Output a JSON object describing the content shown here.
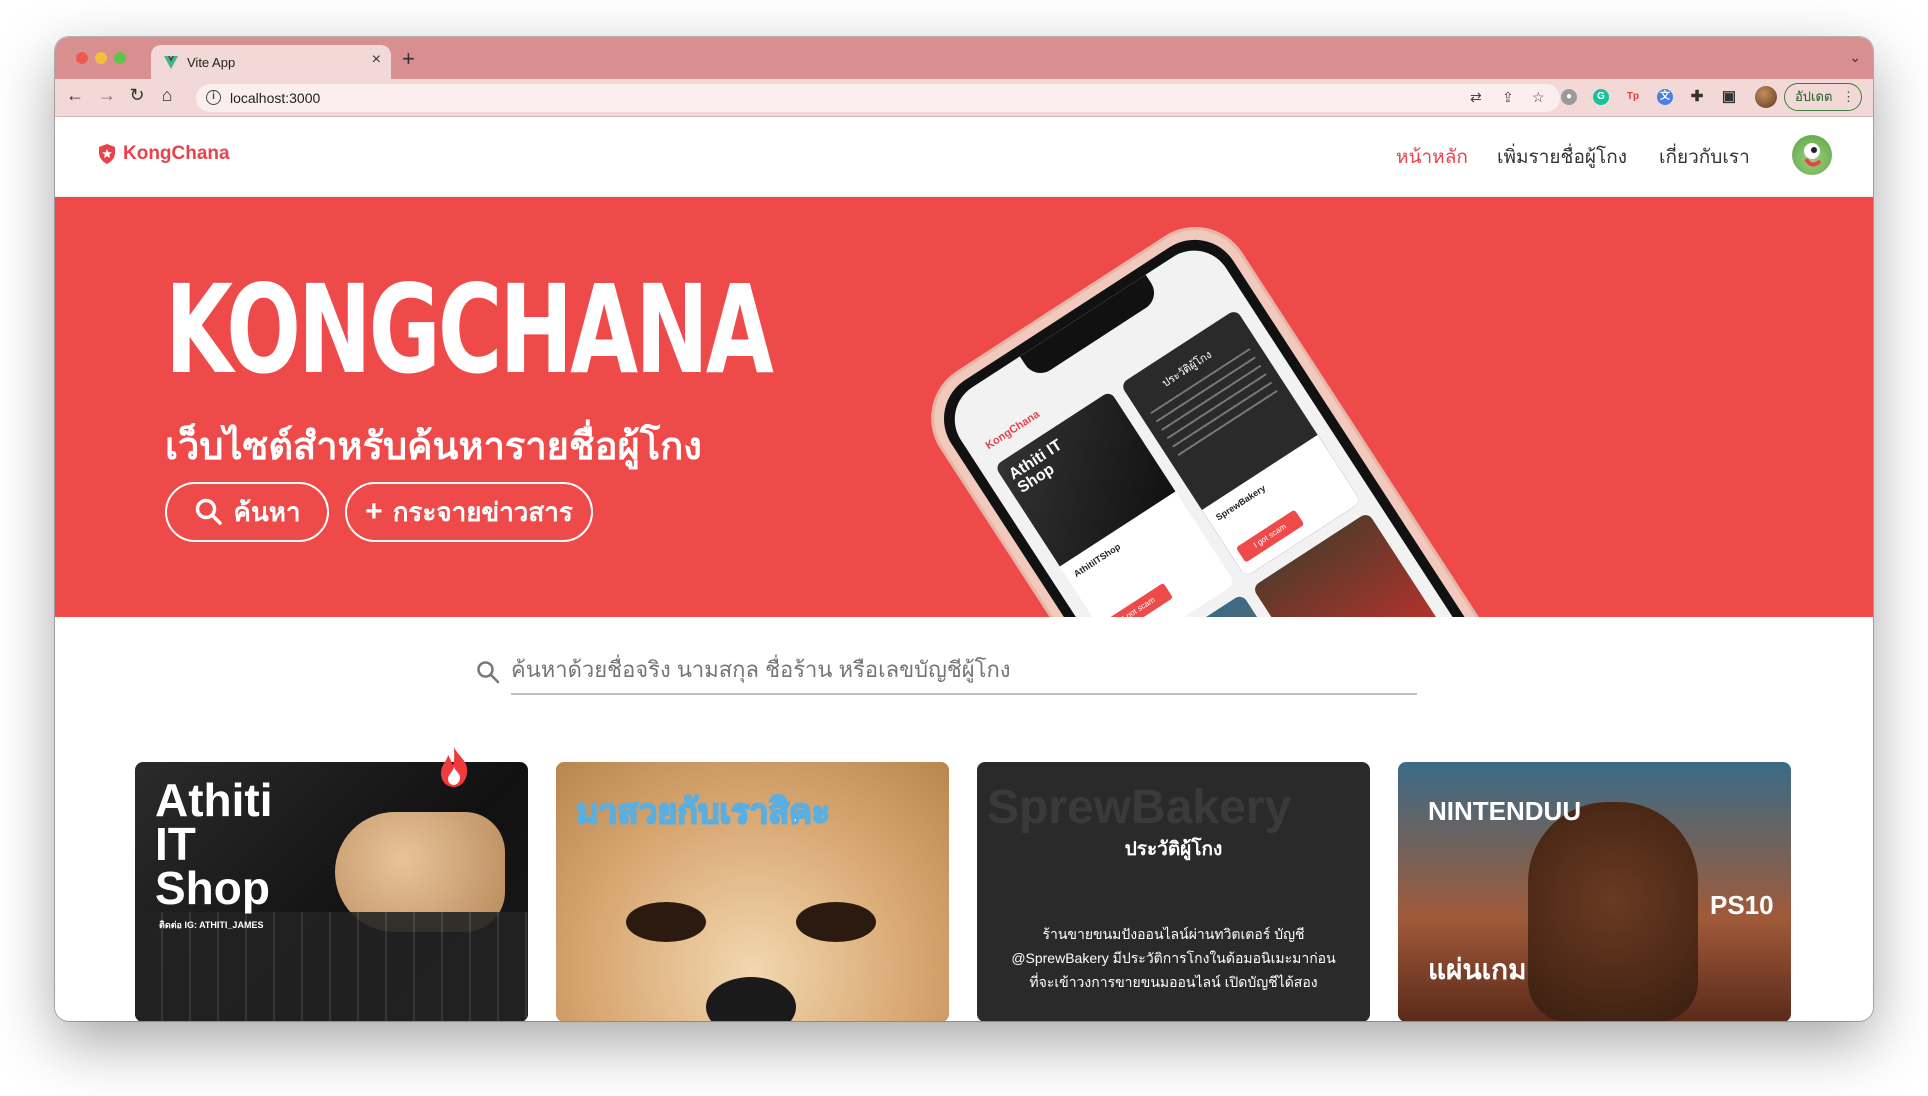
{
  "browser": {
    "tab_title": "Vite App",
    "url": "localhost:3000",
    "update_label": "อัปเดต"
  },
  "site": {
    "brand": "KongChana",
    "nav": [
      {
        "label": "หน้าหลัก"
      },
      {
        "label": "เพิ่มรายชื่อผู้โกง"
      },
      {
        "label": "เกี่ยวกับเรา"
      }
    ]
  },
  "hero": {
    "title": "KONGCHANA",
    "subtitle": "เว็บไซต์สำหรับค้นหารายชื่อผู้โกง",
    "search_button": "ค้นหา",
    "broadcast_button": "กระจายข่าวสาร"
  },
  "phone_preview": {
    "brand": "KongChana",
    "card1_title": "Athiti IT Shop",
    "card1_name": "AthitiITShop",
    "card2_heading": "ประวัติผู้โกง",
    "card2_name": "SprewBakery",
    "button": "I got scam"
  },
  "search": {
    "placeholder": "ค้นหาด้วยชื่อจริง นามสกุล ชื่อร้าน หรือเลขบัญชีผู้โกง"
  },
  "cards": [
    {
      "title_line1": "Athiti",
      "title_line2": "IT",
      "title_line3": "Shop",
      "small": "ติดต่อ IG: ATHITI_JAMES"
    },
    {
      "caption": "มาสวยกับเราสิคะ"
    },
    {
      "watermark": "SprewBakery",
      "heading": "ประวัติผู้โกง",
      "body_line1": "ร้านขายขนมปังออนไลน์ผ่านทวิตเตอร์ บัญชี",
      "body_line2": "@SprewBakery มีประวัติการโกงในด้อมอนิเมะมาก่อน",
      "body_line3": "ที่จะเข้าวงการขายขนมออนไลน์ เปิดบัญชีได้สอง"
    },
    {
      "caption_top": "NINTENDUU",
      "caption_right": "PS10",
      "caption_bottom": "แผ่นเกม"
    }
  ],
  "colors": {
    "brand_red": "#ef4a4a",
    "chrome_pink": "#d98f8f"
  }
}
